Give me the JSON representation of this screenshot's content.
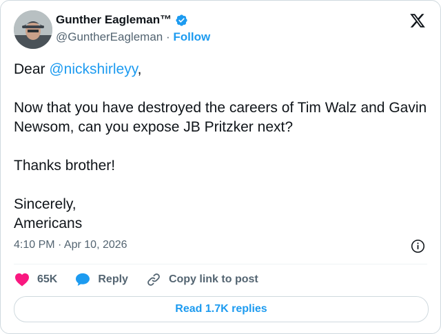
{
  "author": {
    "display_name": "Gunther Eagleman™",
    "handle": "@GuntherEagleman",
    "separator": "·",
    "follow_label": "Follow"
  },
  "post": {
    "greeting_prefix": "Dear ",
    "mention": "@nickshirleyy",
    "greeting_suffix": ",",
    "line2": "Now that you have destroyed the careers of Tim Walz and Gavin Newsom, can you expose JB Pritzker next?",
    "line3": "Thanks brother!",
    "signoff": "Sincerely,",
    "signature": "Americans"
  },
  "timestamp": "4:10 PM · Apr 10, 2026",
  "actions": {
    "like_count": "65K",
    "reply_label": "Reply",
    "copy_link_label": "Copy link to post"
  },
  "read_replies_label": "Read 1.7K replies",
  "icons": {
    "avatar": "avatar",
    "verified": "verified-badge-icon",
    "logo": "x-logo-icon",
    "info": "info-icon",
    "like": "heart-icon",
    "reply": "reply-bubble-icon",
    "copy": "link-icon"
  },
  "colors": {
    "accent": "#1d9bf0",
    "like": "#f91880",
    "text": "#0f1419",
    "muted": "#536471"
  }
}
